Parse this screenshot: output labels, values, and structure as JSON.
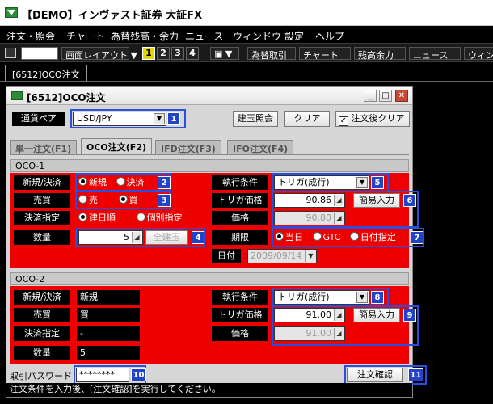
{
  "app": {
    "title": "【DEMO】インヴァスト証券 大証FX"
  },
  "menu": [
    "注文・照会",
    "チャート",
    "為替残高・余力",
    "ニュース",
    "ウィンドウ",
    "設定",
    "ヘルプ"
  ],
  "toolbar": {
    "layout_label": "画面レイアウト",
    "layout_numbers": [
      "1",
      "2",
      "3",
      "4"
    ],
    "active_layout": "1",
    "buttons": [
      "為替取引",
      "チャート",
      "残高余力",
      "ニュース",
      "ウィンドウ"
    ]
  },
  "tab": {
    "label": "[6512]OCO注文"
  },
  "dialog": {
    "title": "[6512]OCO注文",
    "pair_label": "通貨ペア",
    "pair_value": "USD/JPY",
    "btn_positions": "建玉照会",
    "btn_clear": "クリア",
    "after_clear_label": "注文後クリア",
    "after_clear_checked": true,
    "subtabs": [
      "単一注文(F1)",
      "OCO注文(F2)",
      "IFD注文(F3)",
      "IFO注文(F4)"
    ],
    "active_subtab": "OCO注文(F2)",
    "oco1": {
      "title": "OCO-1",
      "new_settle_label": "新規/決済",
      "new_opt": "新規",
      "settle_opt": "決済",
      "side_label": "売買",
      "sell_opt": "売",
      "buy_opt": "買",
      "settle_spec_label": "決済指定",
      "opt_date": "建日順",
      "opt_individual": "個別指定",
      "qty_label": "数量",
      "qty_value": "5",
      "all_positions_btn": "全建玉",
      "exec_cond_label": "執行条件",
      "exec_cond_value": "トリガ(成行)",
      "trigger_label": "トリガ価格",
      "trigger_value": "90.86",
      "easy_input_btn": "簡易入力",
      "price_label": "価格",
      "price_value": "90.80",
      "period_label": "期限",
      "period_today": "当日",
      "period_gtc": "GTC",
      "period_date": "日付指定",
      "date_label": "日付",
      "date_value": "2009/09/14"
    },
    "oco2": {
      "title": "OCO-2",
      "new_settle_label": "新規/決済",
      "new_settle_value": "新規",
      "side_label": "売買",
      "side_value": "買",
      "settle_spec_label": "決済指定",
      "settle_spec_value": "-",
      "qty_label": "数量",
      "qty_value": "5",
      "exec_cond_label": "執行条件",
      "exec_cond_value": "トリガ(成行)",
      "trigger_label": "トリガ価格",
      "trigger_value": "91.00",
      "easy_input_btn": "簡易入力",
      "price_label": "価格",
      "price_value": "91.00"
    },
    "password_label": "取引パスワード",
    "password_value": "********",
    "confirm_btn": "注文確認",
    "status_text": "注文条件を入力後、[注文確認]を実行してください。"
  },
  "badges": [
    "1",
    "2",
    "3",
    "4",
    "5",
    "6",
    "7",
    "8",
    "9",
    "10",
    "11"
  ],
  "colors": {
    "form_red": "#ee0000",
    "callout_blue": "#2a4ee0",
    "badge_blue": "#2143c9",
    "layout_active": "#e2d600"
  }
}
